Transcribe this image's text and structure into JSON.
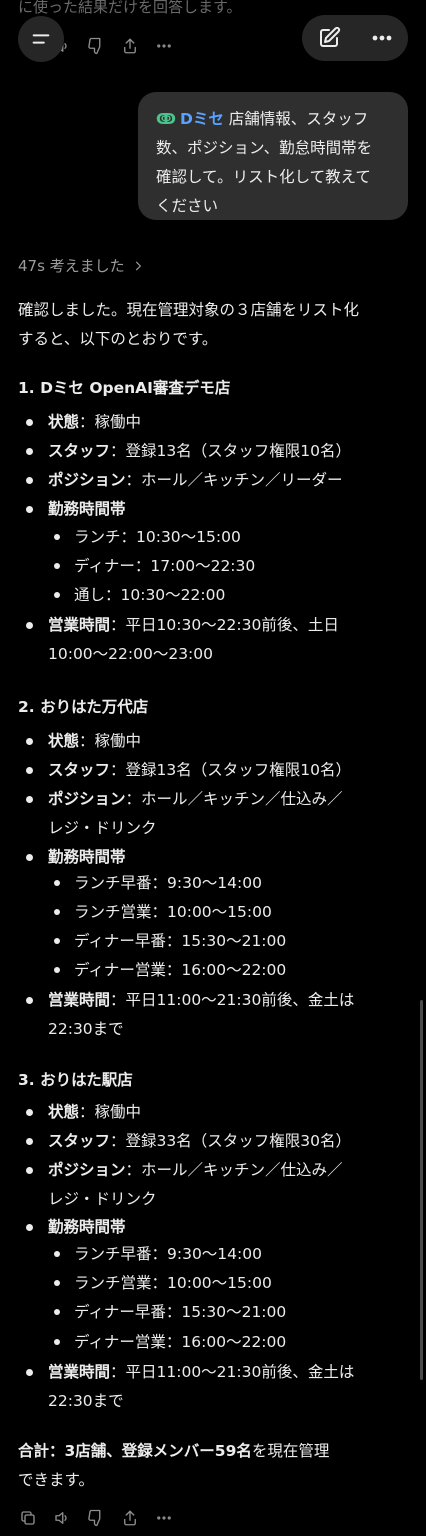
{
  "top_text": "に使った結果だけを回答します。",
  "user_message": {
    "mention_icon": "dmise-logo-icon",
    "mention": "Dミセ",
    "text_line1": "店舗情報、スタッフ",
    "text_line2": "数、ポジション、勤怠時間帯を",
    "text_line3": "確認して。リスト化して教えて",
    "text_line4": "ください"
  },
  "thought_label": "47s 考えました",
  "intro_line1": "確認しました。現在管理対象の３店舗をリスト化",
  "intro_line2": "すると、以下のとおりです。",
  "stores": [
    {
      "heading": "1. Dミセ OpenAI審査デモ店",
      "status_label": "状態",
      "status": "：稼働中",
      "staff_label": "スタッフ",
      "staff": "：登録13名（スタッフ権限10名）",
      "position_label": "ポジション",
      "position_line1": "：ホール／キッチン／リーダー",
      "shift_label": "勤務時間帯",
      "shifts": [
        "ランチ：10:30〜15:00",
        "ディナー：17:00〜22:30",
        "通し：10:30〜22:00"
      ],
      "hours_label": "営業時間",
      "hours_line1": "：平日10:30〜22:30前後、土日",
      "hours_line2": "10:00〜22:00〜23:00"
    },
    {
      "heading": "2. おりはた万代店",
      "status_label": "状態",
      "status": "：稼働中",
      "staff_label": "スタッフ",
      "staff": "：登録13名（スタッフ権限10名）",
      "position_label": "ポジション",
      "position_line1": "：ホール／キッチン／仕込み／",
      "position_line2": "レジ・ドリンク",
      "shift_label": "勤務時間帯",
      "shifts": [
        "ランチ早番：9:30〜14:00",
        "ランチ営業：10:00〜15:00",
        "ディナー早番：15:30〜21:00",
        "ディナー営業：16:00〜22:00"
      ],
      "hours_label": "営業時間",
      "hours_line1": "：平日11:00〜21:30前後、金土は",
      "hours_line2": "22:30まで"
    },
    {
      "heading": "3. おりはた駅店",
      "status_label": "状態",
      "status": "：稼働中",
      "staff_label": "スタッフ",
      "staff": "：登録33名（スタッフ権限30名）",
      "position_label": "ポジション",
      "position_line1": "：ホール／キッチン／仕込み／",
      "position_line2": "レジ・ドリンク",
      "shift_label": "勤務時間帯",
      "shifts": [
        "ランチ早番：9:30〜14:00",
        "ランチ営業：10:00〜15:00",
        "ディナー早番：15:30〜21:00",
        "ディナー営業：16:00〜22:00"
      ],
      "hours_label": "営業時間",
      "hours_line1": "：平日11:00〜21:30前後、金土は",
      "hours_line2": "22:30まで"
    }
  ],
  "total_bold": "合計：3店舗、登録メンバー59名",
  "total_rest": "を現在管理",
  "total_line2": "できます。",
  "action_icons": [
    "copy-icon",
    "speaker-icon",
    "thumbs-down-icon",
    "share-icon",
    "more-icon"
  ]
}
